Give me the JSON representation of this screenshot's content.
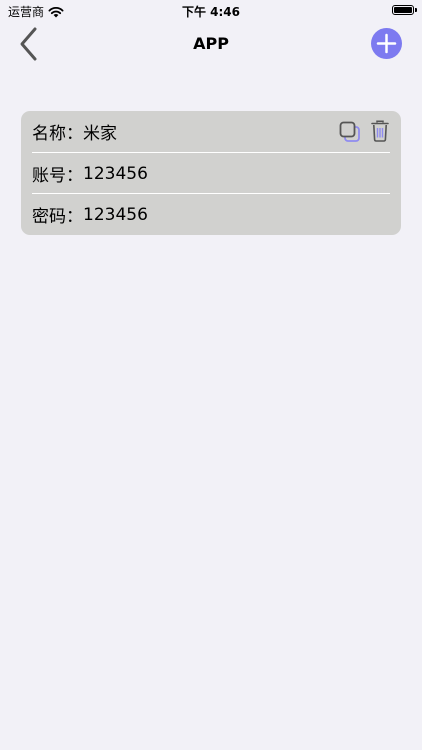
{
  "status_bar": {
    "carrier": "运营商",
    "time": "下午 4:46"
  },
  "nav": {
    "title": "APP"
  },
  "card": {
    "name_label": "名称：",
    "name_value": "米家",
    "account_label": "账号：",
    "account_value": "123456",
    "password_label": "密码：",
    "password_value": "123456"
  },
  "colors": {
    "background": "#f2f1f7",
    "card": "#d1d1cf",
    "accent": "#7d7af0"
  },
  "icons": {
    "back": "chevron-left-icon",
    "add": "plus-icon",
    "copy": "copy-icon",
    "delete": "trash-icon",
    "wifi": "wifi-icon",
    "battery": "battery-icon"
  }
}
